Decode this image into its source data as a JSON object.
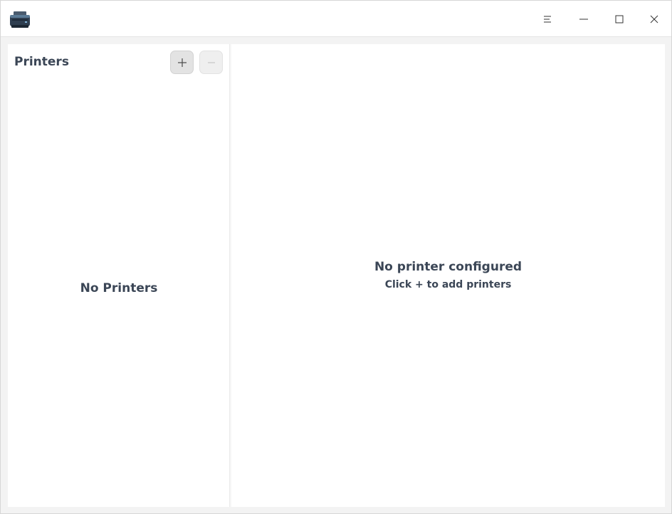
{
  "titlebar": {
    "app_icon": "printer-icon",
    "controls": [
      "menu-icon",
      "minimize-icon",
      "maximize-icon",
      "close-icon"
    ]
  },
  "sidebar": {
    "title": "Printers",
    "add_icon": "plus-icon",
    "remove_icon": "minus-icon",
    "empty_text": "No Printers"
  },
  "main": {
    "empty_title": "No printer configured",
    "empty_subtitle": "Click + to add printers"
  },
  "colors": {
    "text": "#3b4656",
    "window_bg": "#f3f3f3",
    "panel_bg": "#ffffff",
    "button_bg": "#e3e3e3"
  }
}
